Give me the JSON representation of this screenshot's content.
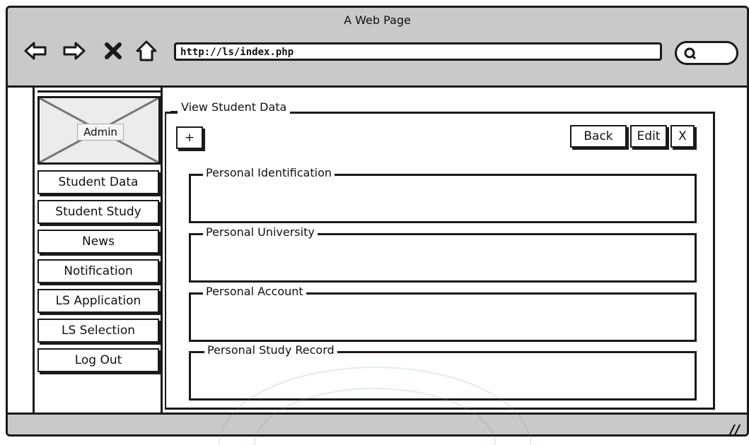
{
  "browser": {
    "title": "A Web Page",
    "url": "http://ls/index.php",
    "nav_icons": [
      "back-arrow-icon",
      "forward-arrow-icon",
      "close-x-icon",
      "home-icon"
    ],
    "search_icon": "search-icon"
  },
  "sidebar": {
    "avatar_label": "Admin",
    "items": [
      {
        "label": "Student Data"
      },
      {
        "label": "Student Study"
      },
      {
        "label": "News"
      },
      {
        "label": "Notification"
      },
      {
        "label": "LS Application"
      },
      {
        "label": "LS Selection"
      },
      {
        "label": "Log Out"
      }
    ]
  },
  "main": {
    "panel_title": "View Student Data",
    "add_label": "+",
    "back_label": "Back",
    "edit_label": "Edit",
    "close_label": "X",
    "sections": [
      {
        "title": "Personal Identification"
      },
      {
        "title": "Personal University"
      },
      {
        "title": "Personal Account"
      },
      {
        "title": "Personal Study Record"
      }
    ]
  },
  "colors": {
    "chrome": "#c9c9c9",
    "ink": "#1a1a1a",
    "watermark": "#4caf50"
  }
}
